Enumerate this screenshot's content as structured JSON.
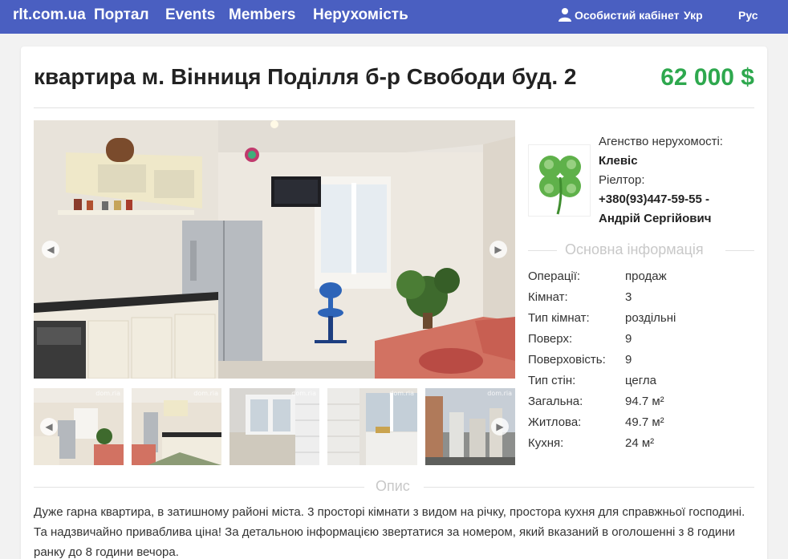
{
  "nav": {
    "brand": "rlt.com.ua",
    "items": [
      "Портал",
      "Events",
      "Members",
      "Нерухомість"
    ],
    "cabinet": "Особистий кабінет",
    "lang_ukr": "Укр",
    "lang_rus": "Рус"
  },
  "listing": {
    "title": "квартира м. Вінниця Поділля б-р Свободи буд. 2",
    "price": "62 000 $"
  },
  "gallery": {
    "watermark": "dom.ria"
  },
  "agency": {
    "agency_label": "Агенство нерухомості:",
    "agency_name": "Клевіс",
    "realtor_label": "Ріелтор:",
    "realtor_phone": "+380(93)447-59-55 -",
    "realtor_name": "Андрій Сергійович"
  },
  "info": {
    "section_title": "Основна інформація",
    "rows": [
      {
        "key": "Операції:",
        "value": "продаж"
      },
      {
        "key": "Кімнат:",
        "value": "3"
      },
      {
        "key": "Тип кімнат:",
        "value": "роздільні"
      },
      {
        "key": "Поверх:",
        "value": "9"
      },
      {
        "key": "Поверховість:",
        "value": "9"
      },
      {
        "key": "Тип стін:",
        "value": "цегла"
      },
      {
        "key": "Загальна:",
        "value": "94.7 м²"
      },
      {
        "key": "Житлова:",
        "value": "49.7 м²"
      },
      {
        "key": "Кухня:",
        "value": "24 м²"
      }
    ]
  },
  "description": {
    "section_title": "Опис",
    "text": "Дуже гарна квартира, в затишному районі міста. 3 просторі кімнати з видом на річку, простора кухня для справжньої господині. Та надзвичайно приваблива ціна! За детальною інформацією звертатися за номером, який вказаний в оголошенні з 8 години ранку до 8 години вечора."
  },
  "colors": {
    "nav_bg": "#4a5fc1",
    "price": "#2ea84e",
    "section_title": "#c8c8c8"
  }
}
